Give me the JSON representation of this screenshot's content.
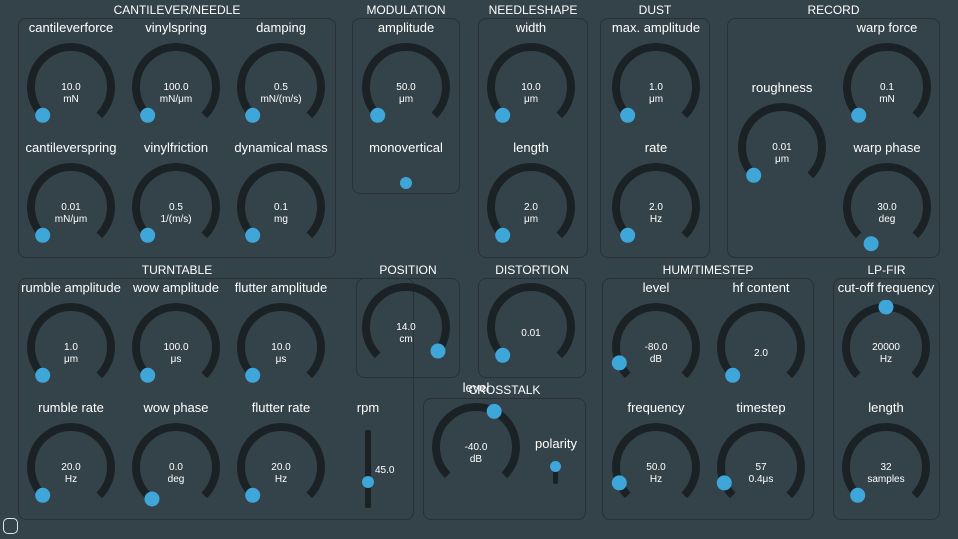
{
  "colors": {
    "background": "#34434a",
    "border": "#2a3035",
    "knob_track": "#1b2226",
    "accent": "#3ea6d8",
    "text": "#ffffff"
  },
  "groups": {
    "cantilever": "CANTILEVER/NEEDLE",
    "modulation": "MODULATION",
    "needleshape": "NEEDLESHAPE",
    "dust": "DUST",
    "record": "RECORD",
    "turntable": "TURNTABLE",
    "position": "POSITION",
    "distortion": "DISTORTION",
    "crosstalk": "CROSSTALK",
    "hum": "HUM/TIMESTEP",
    "lpfir": "LP-FIR"
  },
  "knobs": {
    "cantileverforce": {
      "label": "cantileverforce",
      "value": "10.0",
      "unit": "mN",
      "level": 0.0
    },
    "vinylspring": {
      "label": "vinylspring",
      "value": "100.0",
      "unit": "mN/μm",
      "level": 0.0
    },
    "damping": {
      "label": "damping",
      "value": "0.5",
      "unit": "mN/(m/s)",
      "level": 0.0
    },
    "cantileverspring": {
      "label": "cantileverspring",
      "value": "0.01",
      "unit": "mN/μm",
      "level": 0.0
    },
    "vinylfriction": {
      "label": "vinylfriction",
      "value": "0.5",
      "unit": "1/(m/s)",
      "level": 0.0
    },
    "dynamical_mass": {
      "label": "dynamical mass",
      "value": "0.1",
      "unit": "mg",
      "level": 0.0
    },
    "amplitude": {
      "label": "amplitude",
      "value": "50.0",
      "unit": "μm",
      "level": 0.0
    },
    "width": {
      "label": "width",
      "value": "10.0",
      "unit": "μm",
      "level": 0.0
    },
    "length": {
      "label": "length",
      "value": "2.0",
      "unit": "μm",
      "level": 0.0
    },
    "max_amplitude": {
      "label": "max. amplitude",
      "value": "1.0",
      "unit": "μm",
      "level": 0.0
    },
    "rate": {
      "label": "rate",
      "value": "2.0",
      "unit": "Hz",
      "level": 0.0
    },
    "roughness": {
      "label": "roughness",
      "value": "0.01",
      "unit": "μm",
      "level": 0.0
    },
    "warp_force": {
      "label": "warp force",
      "value": "0.1",
      "unit": "mN",
      "level": 0.0
    },
    "warp_phase": {
      "label": "warp phase",
      "value": "30.0",
      "unit": "deg",
      "level": -0.08
    },
    "rumble_amplitude": {
      "label": "rumble amplitude",
      "value": "1.0",
      "unit": "μm",
      "level": 0.0
    },
    "wow_amplitude": {
      "label": "wow amplitude",
      "value": "100.0",
      "unit": "μs",
      "level": 0.0
    },
    "flutter_amplitude": {
      "label": "flutter amplitude",
      "value": "10.0",
      "unit": "μs",
      "level": 0.0
    },
    "rumble_rate": {
      "label": "rumble rate",
      "value": "20.0",
      "unit": "Hz",
      "level": 0.0
    },
    "wow_phase": {
      "label": "wow phase",
      "value": "0.0",
      "unit": "deg",
      "level": -0.03
    },
    "flutter_rate": {
      "label": "flutter rate",
      "value": "20.0",
      "unit": "Hz",
      "level": 0.0
    },
    "position": {
      "label": "",
      "value": "14.0",
      "unit": "cm",
      "level": 0.97
    },
    "distortion": {
      "label": "",
      "value": "0.01",
      "unit": "",
      "level": 0.0
    },
    "crosstalk_level": {
      "label": "level",
      "value": "-40.0",
      "unit": "dB",
      "level": 0.6
    },
    "hum_level": {
      "label": "level",
      "value": "-80.0",
      "unit": "dB",
      "level": 0.08
    },
    "hf_content": {
      "label": "hf content",
      "value": "2.0",
      "unit": "",
      "level": 0.0
    },
    "frequency": {
      "label": "frequency",
      "value": "50.0",
      "unit": "Hz",
      "level": 0.08
    },
    "timestep": {
      "label": "timestep",
      "value": "57",
      "unit": "0.4μs",
      "level": 0.08
    },
    "cutoff": {
      "label": "cut-off frequency",
      "value": "20000",
      "unit": "Hz",
      "level": 0.5
    },
    "fir_length": {
      "label": "length",
      "value": "32",
      "unit": "samples",
      "level": 0.0
    }
  },
  "sliders": {
    "monovertical": {
      "label": "monovertical",
      "level": 0.0
    },
    "rpm": {
      "label": "rpm",
      "value": "45.0",
      "level": 0.3
    },
    "polarity": {
      "label": "polarity",
      "level": 1.0
    }
  }
}
